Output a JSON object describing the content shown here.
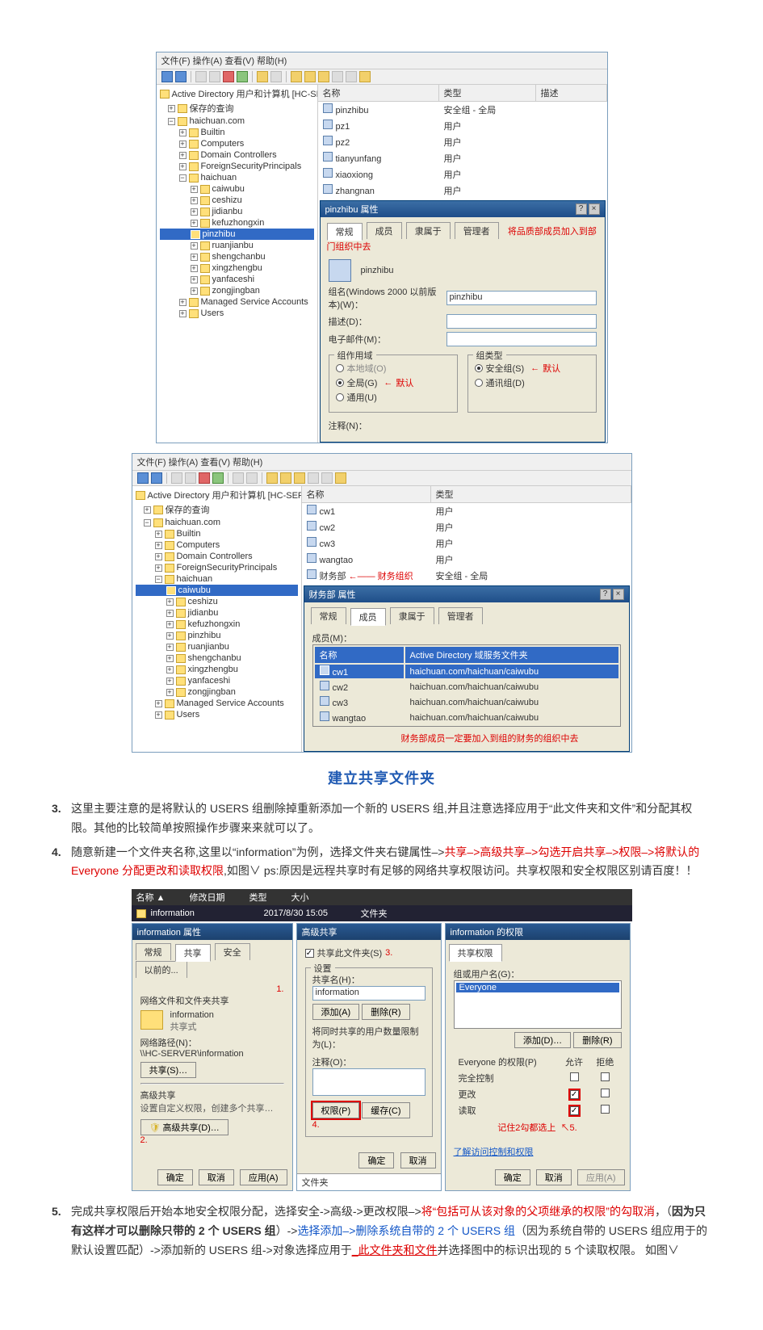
{
  "screenshot1": {
    "menu": "文件(F)  操作(A)  查看(V)  帮助(H)",
    "root_label": "Active Directory 用户和计算机 [HC-SERVER.hai...]",
    "tree": [
      "保存的查询",
      "haichuan.com",
      "Builtin",
      "Computers",
      "Domain Controllers",
      "ForeignSecurityPrincipals",
      "haichuan",
      "caiwubu",
      "ceshizu",
      "jidianbu",
      "kefuzhongxin",
      "pinzhibu",
      "ruanjianbu",
      "shengchanbu",
      "xingzhengbu",
      "yanfaceshi",
      "zongjingban",
      "Managed Service Accounts",
      "Users"
    ],
    "list_head_name": "名称",
    "list_head_type": "类型",
    "list_head_desc": "描述",
    "rows": [
      {
        "name": "pinzhibu",
        "type": "安全组 - 全局"
      },
      {
        "name": "pz1",
        "type": "用户"
      },
      {
        "name": "pz2",
        "type": "用户"
      },
      {
        "name": "tianyunfang",
        "type": "用户"
      },
      {
        "name": "xiaoxiong",
        "type": "用户"
      },
      {
        "name": "zhangnan",
        "type": "用户"
      }
    ],
    "dlg_title": "pinzhibu 属性",
    "tabs": [
      "常规",
      "成员",
      "隶属于",
      "管理者"
    ],
    "annot_top": "将品质部成员加入到部门组织中去",
    "dlg_name": "pinzhibu",
    "field_groupname": "组名(Windows 2000 以前版本)(W)：",
    "field_groupname_val": "pinzhibu",
    "field_desc": "描述(D)：",
    "field_email": "电子邮件(M)：",
    "scope_label": "组作用域",
    "scope_opts": [
      "本地域(O)",
      "全局(G)",
      "通用(U)"
    ],
    "scope_note": "默认",
    "type_label": "组类型",
    "type_opts": [
      "安全组(S)",
      "通讯组(D)"
    ],
    "type_note": "默认",
    "notes_label": "注释(N)："
  },
  "screenshot2": {
    "menu": "文件(F)  操作(A)  查看(V)  帮助(H)",
    "root_label": "Active Directory 用户和计算机 [HC-SERVER.hai...]",
    "tree": [
      "保存的查询",
      "haichuan.com",
      "Builtin",
      "Computers",
      "Domain Controllers",
      "ForeignSecurityPrincipals",
      "haichuan",
      "caiwubu",
      "ceshizu",
      "jidianbu",
      "kefuzhongxin",
      "pinzhibu",
      "ruanjianbu",
      "shengchanbu",
      "xingzhengbu",
      "yanfaceshi",
      "zongjingban",
      "Managed Service Accounts",
      "Users"
    ],
    "list_head_name": "名称",
    "list_head_type": "类型",
    "rows": [
      {
        "name": "cw1",
        "type": "用户"
      },
      {
        "name": "cw2",
        "type": "用户"
      },
      {
        "name": "cw3",
        "type": "用户"
      },
      {
        "name": "wangtao",
        "type": "用户"
      },
      {
        "name": "财务部",
        "type": "安全组 - 全局"
      }
    ],
    "arrow_label": "财务组织",
    "dlg_title": "财务部 属性",
    "tabs": [
      "常规",
      "成员",
      "隶属于",
      "管理者"
    ],
    "members_label": "成员(M)：",
    "mem_head_name": "名称",
    "mem_head_adpath": "Active Directory 域服务文件夹",
    "members": [
      {
        "name": "cw1",
        "path": "haichuan.com/haichuan/caiwubu"
      },
      {
        "name": "cw2",
        "path": "haichuan.com/haichuan/caiwubu"
      },
      {
        "name": "cw3",
        "path": "haichuan.com/haichuan/caiwubu"
      },
      {
        "name": "wangtao",
        "path": "haichuan.com/haichuan/caiwubu"
      }
    ],
    "annot_bottom": "财务部成员一定要加入到组的财务的组织中去"
  },
  "section_title": "建立共享文件夹",
  "para3": {
    "num": "3.",
    "text": "这里主要注意的是将默认的 USERS 组删除掉重新添加一个新的 USERS 组,并且注意选择应用于“此文件夹和文件”和分配其权限。其他的比较简单按照操作步骤来来就可以了。"
  },
  "para4": {
    "num": "4.",
    "lead": "随意新建一个文件夹名称,这里以“information”为例，选择文件夹右键属性–>",
    "red_chain": "共享–>高级共享–>勾选开启共享–>权限–>将默认的 Everyone 分配更改和读取权限",
    "tail": ",如图∨    ps:原因是远程共享时有足够的网络共享权限访问。共享权限和安全权限区别请百度！！"
  },
  "share": {
    "expl_cols": [
      "名称 ▲",
      "修改日期",
      "类型",
      "大小"
    ],
    "expl_row_name": "information",
    "expl_row_date": "2017/8/30 15:05",
    "expl_row_type": "文件夹",
    "prop_title": "information 属性",
    "prop_tabs": [
      "常规",
      "共享",
      "安全",
      "以前的..."
    ],
    "net_heading": "网络文件和文件夹共享",
    "net_name": "information",
    "net_state": "共享式",
    "net_path_label": "网络路径(N)：",
    "net_path": "\\\\HC-SERVER\\information",
    "btn_share": "共享(S)…",
    "adv_heading": "高级共享",
    "adv_desc": "设置自定义权限，创建多个共享…",
    "btn_adv": "高级共享(D)…",
    "annot_1": "1.",
    "annot_2": "2.",
    "btn_ok": "确定",
    "btn_cancel": "取消",
    "btn_apply": "应用(A)",
    "adv_dlg_title": "高级共享",
    "adv_checkbox": "共享此文件夹(S)",
    "annot_3": "3.",
    "adv_set_label": "设置",
    "adv_name_label": "共享名(H)：",
    "adv_name_val": "information",
    "btn_add": "添加(A)",
    "btn_remove": "删除(R)",
    "adv_limit_label": "将同时共享的用户数量限制为(L)：",
    "adv_note_label": "注释(O)：",
    "btn_perm": "权限(P)",
    "btn_cache": "缓存(C)",
    "annot_4": "4.",
    "perm_dlg_title": "information 的权限",
    "perm_tab": "共享权限",
    "perm_group_label": "组或用户名(G)：",
    "perm_user": "Everyone",
    "perm_btn_add": "添加(D)…",
    "perm_btn_remove": "删除(R)",
    "perm_head": "Everyone 的权限(P)",
    "perm_allow": "允许",
    "perm_deny": "拒绝",
    "perm_rows": [
      "完全控制",
      "更改",
      "读取"
    ],
    "perm_note": "记住2勾都选上",
    "annot_5": "5.",
    "perm_link": "了解访问控制和权限",
    "perm_btn_ok": "确定",
    "perm_btn_cancel": "取消",
    "perm_btn_apply": "应用(A)",
    "filetab": "文件夹"
  },
  "para5": {
    "num": "5.",
    "a": " 完成共享权限后开始本地安全权限分配，选择安全->高级->更改权限–>",
    "b_red": "将“包括可从该对象的父项继承的权限”的勾取消",
    "c": "，（",
    "d_bold": "因为只有这样才可以删除只带的 2 个 USERS 组",
    "e": "）->",
    "f_blue": "选择添加–>删除系统自带的 2 个 USERS 组",
    "g": "（因为系统自带的 USERS 组应用于的默认设置匹配）->添加新的 USERS 组->对象选择应用于",
    "h_redu": "_此文件夹和文件",
    "i": "并选择图中的标识出现的 5 个读取权限。  如图∨"
  }
}
